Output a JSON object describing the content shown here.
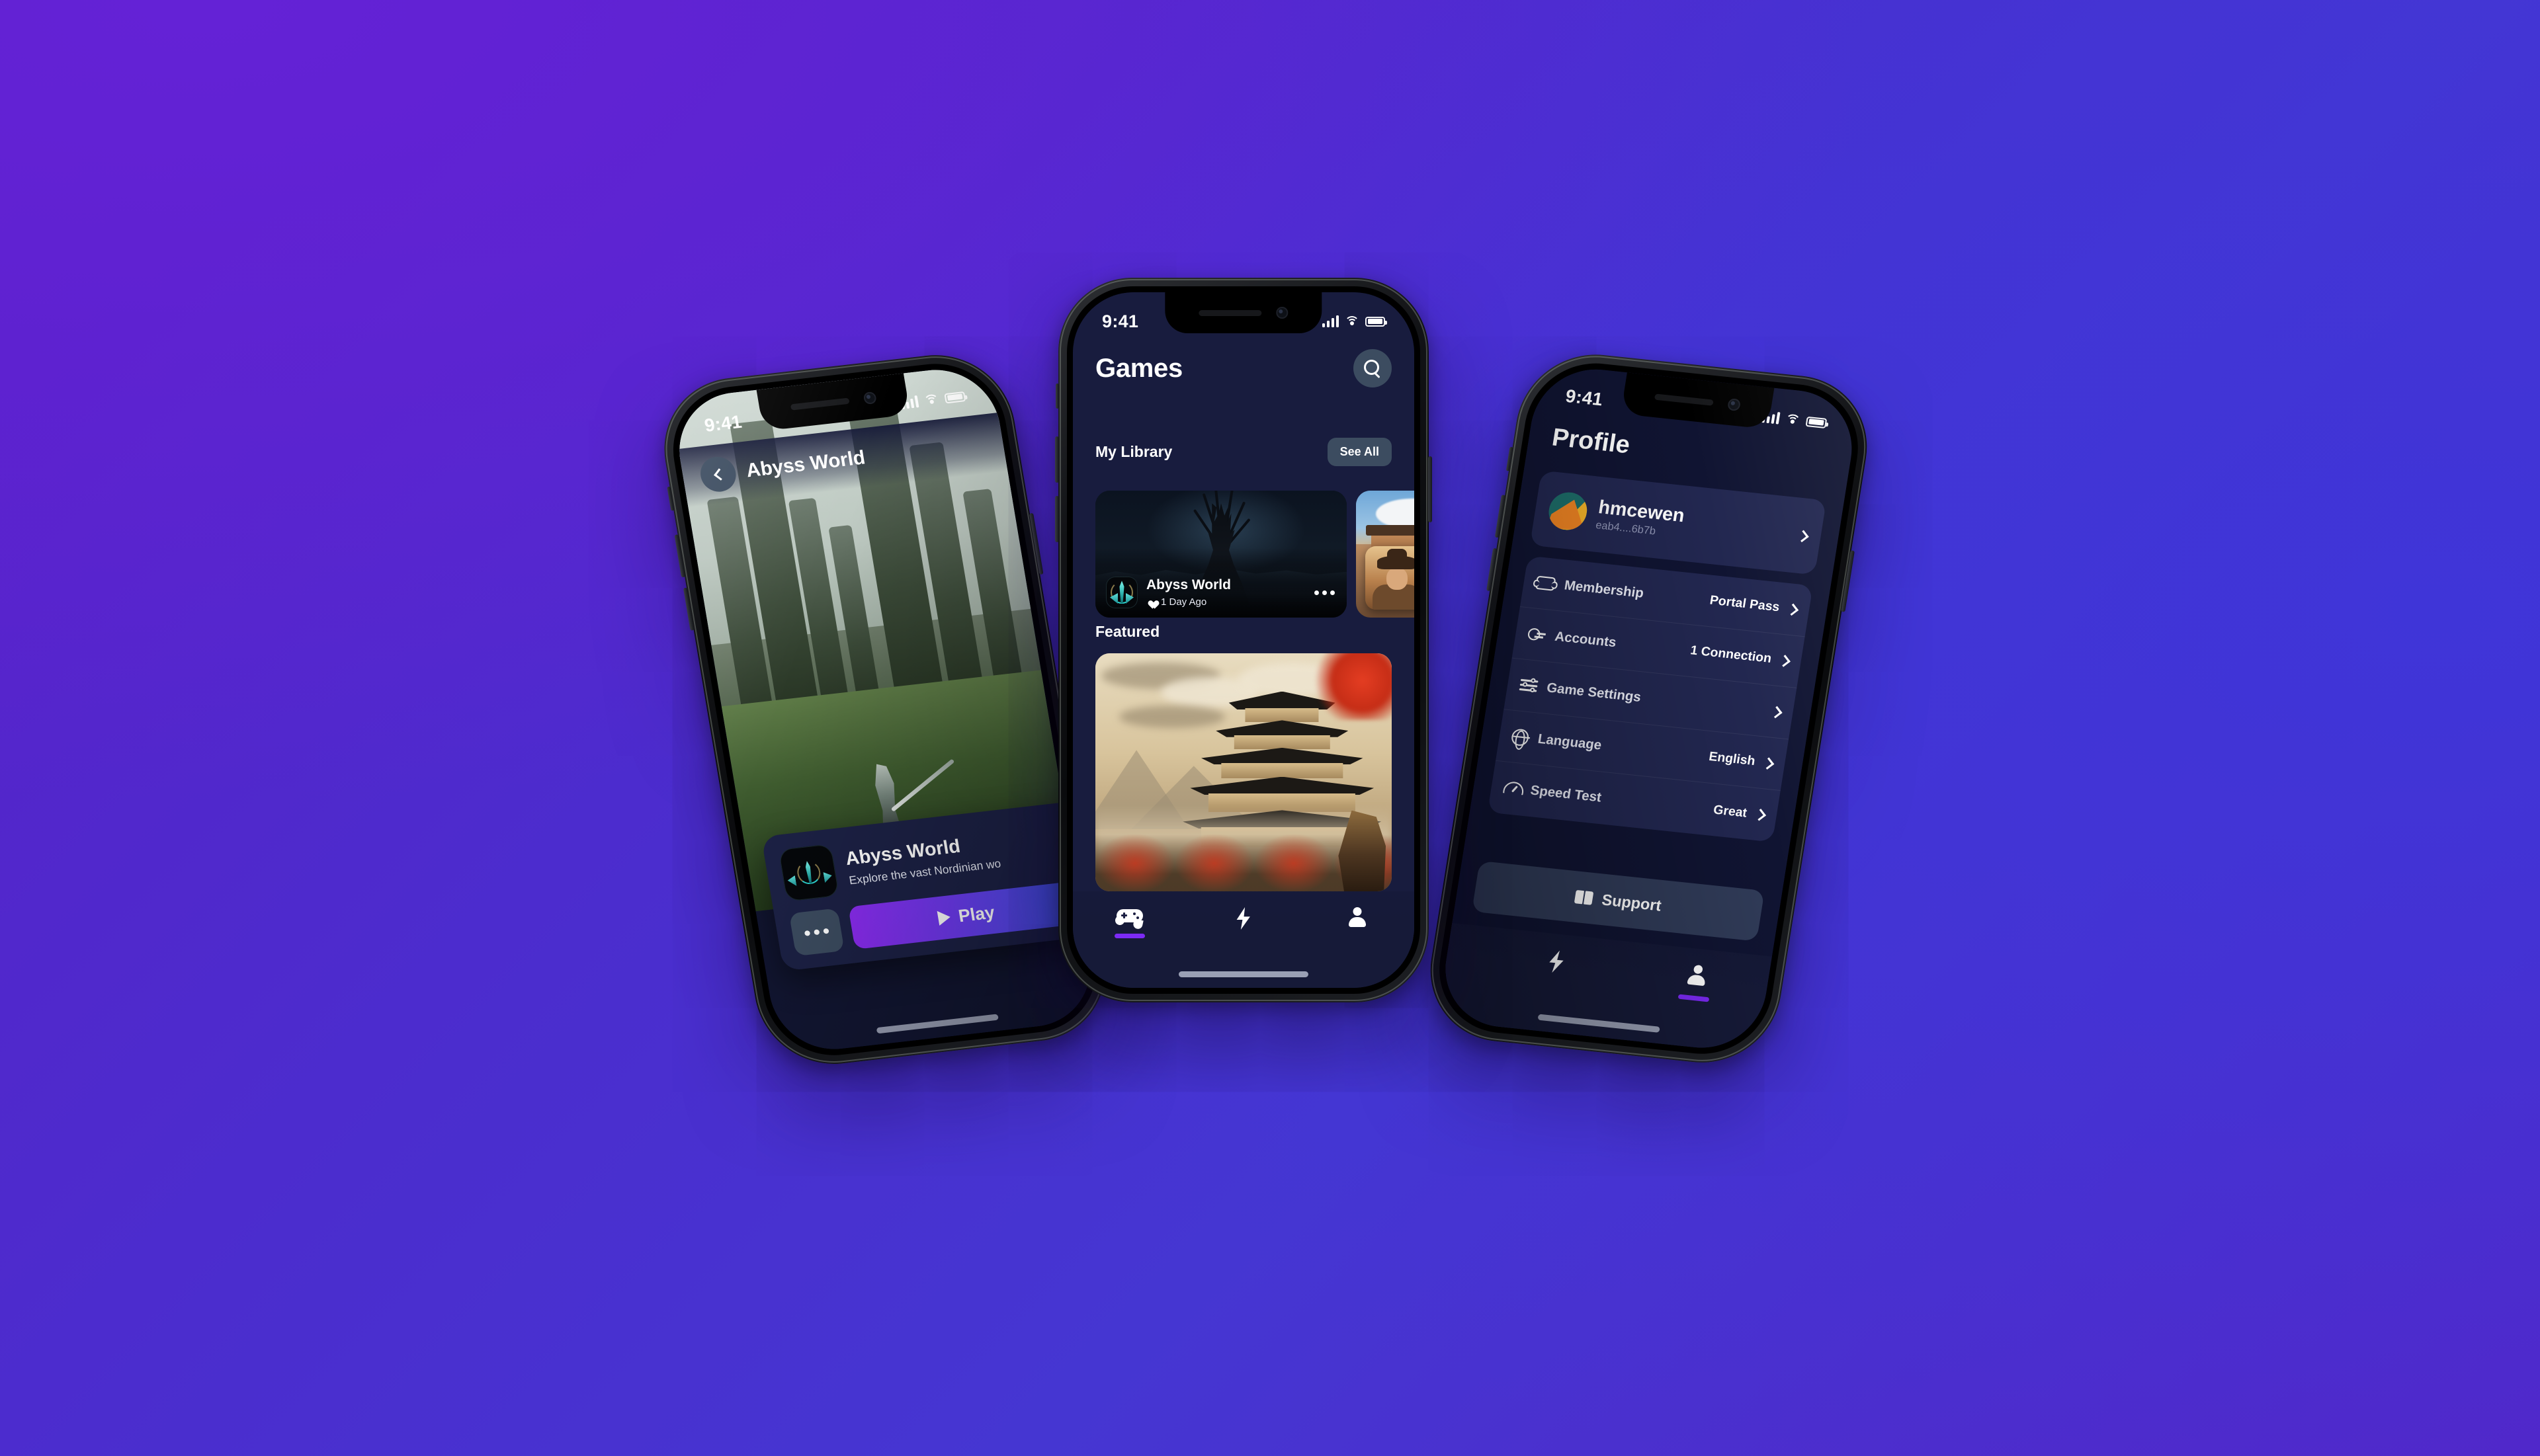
{
  "background": {
    "accent": "#7C2AF5",
    "gradient_from": "#5B1FC8",
    "gradient_to": "#4536D2"
  },
  "status_bar": {
    "time": "9:41",
    "wifi": "wifi-icon",
    "cellular": "signal-icon",
    "battery": "battery-icon"
  },
  "games_screen": {
    "title": "Games",
    "search_icon": "search-icon",
    "my_library": {
      "section_title": "My Library",
      "see_all_label": "See All",
      "cards": [
        {
          "name": "Abyss World",
          "meta": "1 Day Ago",
          "favorite_icon": "heart-icon",
          "more_icon": "ellipsis-icon"
        },
        {
          "name": "",
          "meta": ""
        }
      ]
    },
    "featured": {
      "section_title": "Featured"
    },
    "tabs": [
      {
        "label": "",
        "icon": "gamepad-icon",
        "active": true
      },
      {
        "label": "",
        "icon": "bolt-icon",
        "active": false
      },
      {
        "label": "",
        "icon": "person-icon",
        "active": false
      }
    ]
  },
  "detail_screen": {
    "back_icon": "chevron-left-icon",
    "title": "Abyss World",
    "game_name": "Abyss World",
    "description": "Explore the vast Nordinian wo",
    "more_icon": "ellipsis-icon",
    "play_label": "Play",
    "play_icon": "play-icon"
  },
  "profile_screen": {
    "title": "Profile",
    "user": {
      "name": "hmcewen",
      "address": "eab4....6b7b",
      "avatar": "avatar"
    },
    "settings": [
      {
        "icon": "ticket-icon",
        "label": "Membership",
        "value": "Portal Pass"
      },
      {
        "icon": "key-icon",
        "label": "Accounts",
        "value": "1 Connection"
      },
      {
        "icon": "sliders-icon",
        "label": "Game Settings",
        "value": ""
      },
      {
        "icon": "globe-icon",
        "label": "Language",
        "value": "English"
      },
      {
        "icon": "gauge-icon",
        "label": "Speed Test",
        "value": "Great"
      }
    ],
    "support_label": "Support",
    "support_icon": "book-icon",
    "tabs": [
      {
        "icon": "bolt-icon",
        "active": false
      },
      {
        "icon": "person-icon",
        "active": true
      }
    ]
  }
}
